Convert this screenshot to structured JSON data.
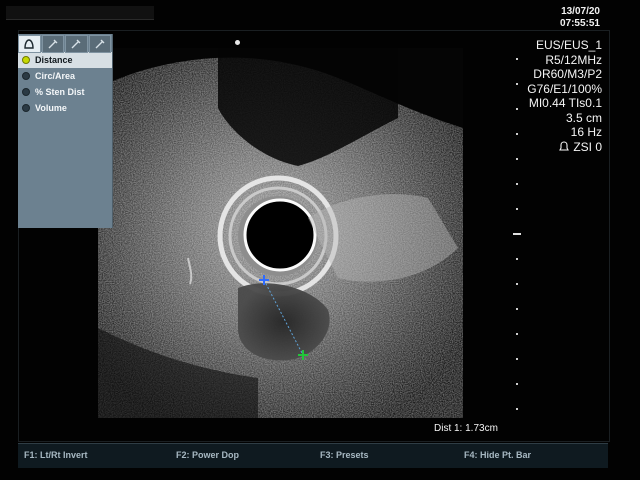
{
  "header": {
    "date": "13/07/20",
    "time": "07:55:51"
  },
  "measure_panel": {
    "tabs": [
      {
        "icon": "probe-icon",
        "active": true
      },
      {
        "icon": "caliper-icon",
        "active": false
      },
      {
        "icon": "caliper-icon",
        "active": false
      },
      {
        "icon": "caliper-icon",
        "active": false
      }
    ],
    "items": [
      {
        "label": "Distance",
        "selected": true
      },
      {
        "label": "Circ/Area",
        "selected": false
      },
      {
        "label": "% Sten Dist",
        "selected": false
      },
      {
        "label": "Volume",
        "selected": false
      }
    ]
  },
  "params": {
    "mode": "EUS/EUS_1",
    "probe": "R5/12MHz",
    "dynamic": "DR60/M3/P2",
    "gain": "G76/E1/100%",
    "mi_tis": "MI0.44  TIs0.1",
    "depth": "3.5 cm",
    "frame_rate": "16 Hz",
    "zsi": "ZSI 0"
  },
  "measurement": {
    "readout": "Dist 1: 1.73cm"
  },
  "function_keys": [
    {
      "label": "F1:  Lt/Rt Invert"
    },
    {
      "label": "F2:  Power Dop"
    },
    {
      "label": "F3:  Presets"
    },
    {
      "label": "F4:  Hide Pt. Bar"
    }
  ],
  "colors": {
    "panel": "#6c8190",
    "selected_bullet": "#c6d900",
    "caliper_start": "#2f6bff",
    "caliper_end": "#22c53a"
  }
}
